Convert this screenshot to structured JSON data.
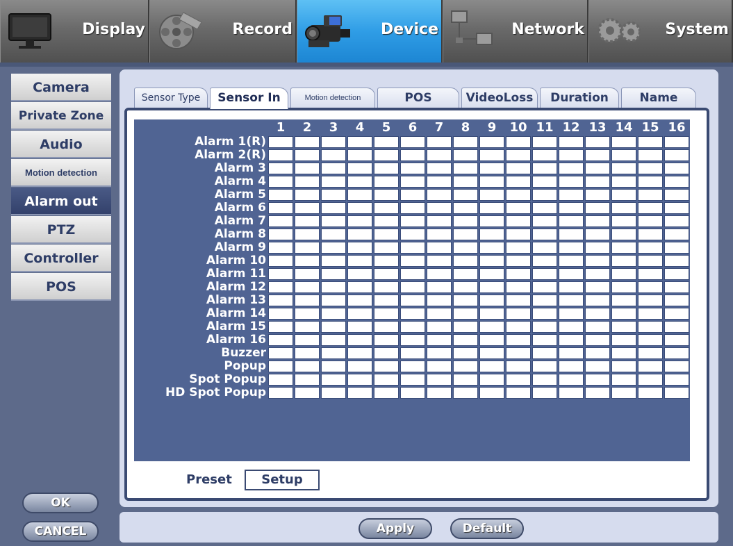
{
  "top_tabs": [
    {
      "label": "Display",
      "icon": "monitor-icon"
    },
    {
      "label": "Record",
      "icon": "film-reel-icon"
    },
    {
      "label": "Device",
      "icon": "camcorder-icon",
      "active": true
    },
    {
      "label": "Network",
      "icon": "network-icon"
    },
    {
      "label": "System",
      "icon": "gears-icon"
    }
  ],
  "sidebar": {
    "items": [
      {
        "label": "Camera"
      },
      {
        "label": "Private Zone"
      },
      {
        "label": "Audio"
      },
      {
        "label": "Motion detection"
      },
      {
        "label": "Alarm out",
        "active": true
      },
      {
        "label": "PTZ"
      },
      {
        "label": "Controller"
      },
      {
        "label": "POS"
      }
    ],
    "ok_label": "OK",
    "cancel_label": "CANCEL"
  },
  "sub_tabs": [
    {
      "label": "Sensor Type"
    },
    {
      "label": "Sensor In",
      "active": true
    },
    {
      "label": "Motion detection"
    },
    {
      "label": "POS"
    },
    {
      "label": "VideoLoss"
    },
    {
      "label": "Duration"
    },
    {
      "label": "Name"
    }
  ],
  "matrix": {
    "columns": [
      "1",
      "2",
      "3",
      "4",
      "5",
      "6",
      "7",
      "8",
      "9",
      "10",
      "11",
      "12",
      "13",
      "14",
      "15",
      "16"
    ],
    "rows": [
      "Alarm 1(R)",
      "Alarm 2(R)",
      "Alarm 3",
      "Alarm 4",
      "Alarm 5",
      "Alarm 6",
      "Alarm 7",
      "Alarm 8",
      "Alarm 9",
      "Alarm 10",
      "Alarm 11",
      "Alarm 12",
      "Alarm 13",
      "Alarm 14",
      "Alarm 15",
      "Alarm 16",
      "Buzzer",
      "Popup",
      "Spot Popup",
      "HD Spot Popup"
    ]
  },
  "preset": {
    "label": "Preset",
    "button": "Setup"
  },
  "footer": {
    "apply_label": "Apply",
    "default_label": "Default"
  },
  "colors": {
    "accent": "#2f9de6",
    "panel": "#d6dcee",
    "grid_header": "#506493",
    "sidebar_active": "#3a4a78"
  }
}
